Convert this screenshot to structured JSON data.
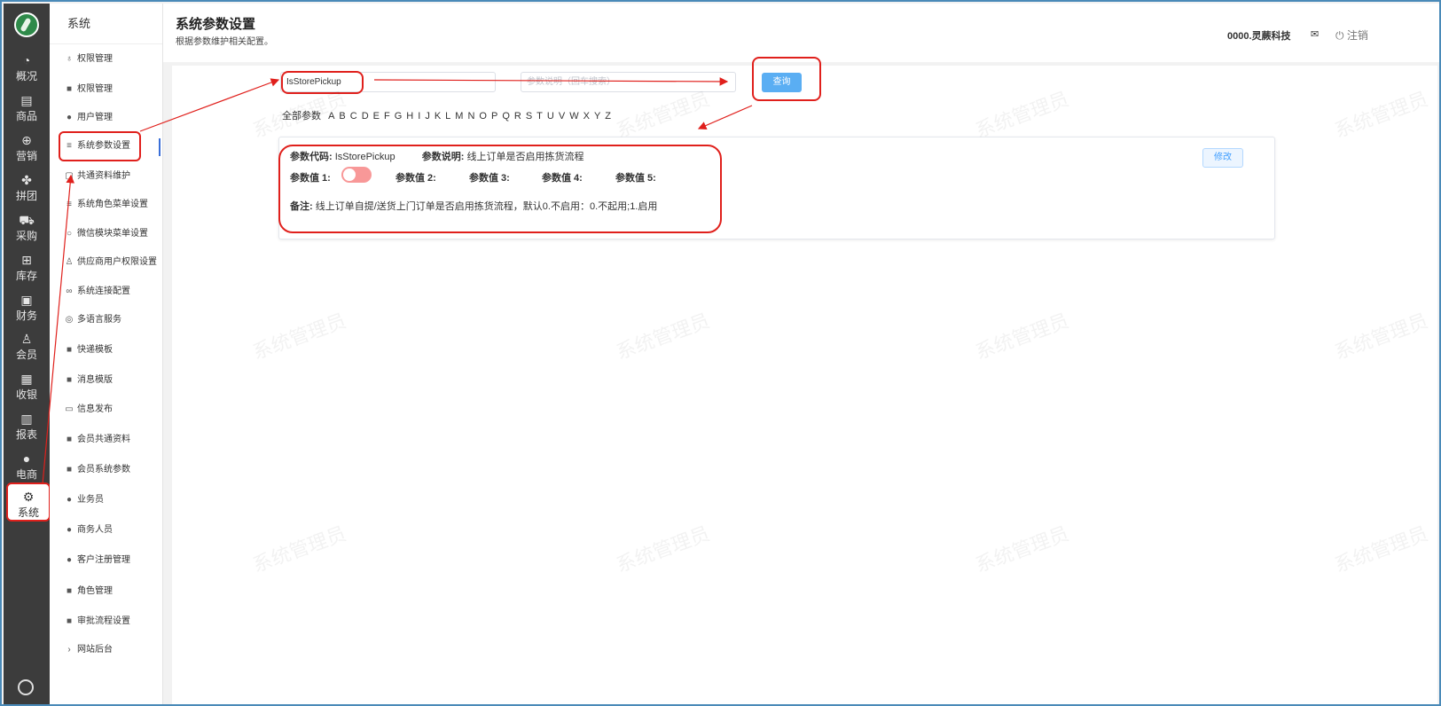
{
  "rail": {
    "items": [
      {
        "label": "概况",
        "icon": "dashboard-icon",
        "glyph": "◔"
      },
      {
        "label": "商品",
        "icon": "document-icon",
        "glyph": "▤"
      },
      {
        "label": "营销",
        "icon": "bag-icon",
        "glyph": "⊕"
      },
      {
        "label": "拼团",
        "icon": "grid-icon",
        "glyph": "✤"
      },
      {
        "label": "采购",
        "icon": "cart-icon",
        "glyph": "⛟"
      },
      {
        "label": "库存",
        "icon": "box-icon",
        "glyph": "⊞"
      },
      {
        "label": "财务",
        "icon": "finance-icon",
        "glyph": "▣"
      },
      {
        "label": "会员",
        "icon": "user-icon",
        "glyph": "♙"
      },
      {
        "label": "收银",
        "icon": "cashier-icon",
        "glyph": "▦"
      },
      {
        "label": "报表",
        "icon": "chart-icon",
        "glyph": "▥"
      },
      {
        "label": "电商",
        "icon": "person-icon",
        "glyph": "●"
      },
      {
        "label": "系统",
        "icon": "settings-icon",
        "glyph": "⚙"
      }
    ]
  },
  "submenu": {
    "title": "系统",
    "items": [
      {
        "label": "权限管理",
        "glyph": "♁"
      },
      {
        "label": "权限管理",
        "glyph": "■"
      },
      {
        "label": "用户管理",
        "glyph": "●"
      },
      {
        "label": "系统参数设置",
        "glyph": "≡"
      },
      {
        "label": "共通资料维护",
        "glyph": "▢"
      },
      {
        "label": "系统角色菜单设置",
        "glyph": "≡"
      },
      {
        "label": "微信模块菜单设置",
        "glyph": "○"
      },
      {
        "label": "供应商用户权限设置",
        "glyph": "♙"
      },
      {
        "label": "系统连接配置",
        "glyph": "∞"
      },
      {
        "label": "多语言服务",
        "glyph": "◎"
      },
      {
        "label": "快递模板",
        "glyph": "■"
      },
      {
        "label": "消息模版",
        "glyph": "■"
      },
      {
        "label": "信息发布",
        "glyph": "▭"
      },
      {
        "label": "会员共通资料",
        "glyph": "■"
      },
      {
        "label": "会员系统参数",
        "glyph": "■"
      },
      {
        "label": "业务员",
        "glyph": "●"
      },
      {
        "label": "商务人员",
        "glyph": "●"
      },
      {
        "label": "客户注册管理",
        "glyph": "●"
      },
      {
        "label": "角色管理",
        "glyph": "■"
      },
      {
        "label": "审批流程设置",
        "glyph": "■"
      },
      {
        "label": "网站后台",
        "glyph": "›"
      }
    ]
  },
  "header": {
    "title": "系统参数设置",
    "subtitle": "根据参数维护相关配置。",
    "company": "0000.灵蕨科技",
    "logout": "注销"
  },
  "search": {
    "code_value": "IsStorePickup",
    "desc_placeholder": "参数说明（回车搜索）",
    "query_label": "查询"
  },
  "filters": {
    "all_label": "全部参数",
    "letters": [
      "A",
      "B",
      "C",
      "D",
      "E",
      "F",
      "G",
      "H",
      "I",
      "J",
      "K",
      "L",
      "M",
      "N",
      "O",
      "P",
      "Q",
      "R",
      "S",
      "T",
      "U",
      "V",
      "W",
      "X",
      "Y",
      "Z"
    ]
  },
  "param_card": {
    "code_key": "参数代码:",
    "code_value": "IsStorePickup",
    "desc_key": "参数说明:",
    "desc_value": "线上订单是否启用拣货流程",
    "val1": "参数值 1:",
    "val2": "参数值 2:",
    "val3": "参数值 3:",
    "val4": "参数值 4:",
    "val5": "参数值 5:",
    "remark_key": "备注:",
    "remark_value": "线上订单自提/送货上门订单是否启用拣货流程，默认0.不启用：0.不起用;1.启用",
    "edit_label": "修改",
    "toggle_on": false
  },
  "watermark": "系统管理员",
  "colors": {
    "accent": "#5aaef3",
    "annotation": "#e0201c",
    "toggle_off": "#f89898",
    "rail_bg": "#3c3c3c"
  }
}
